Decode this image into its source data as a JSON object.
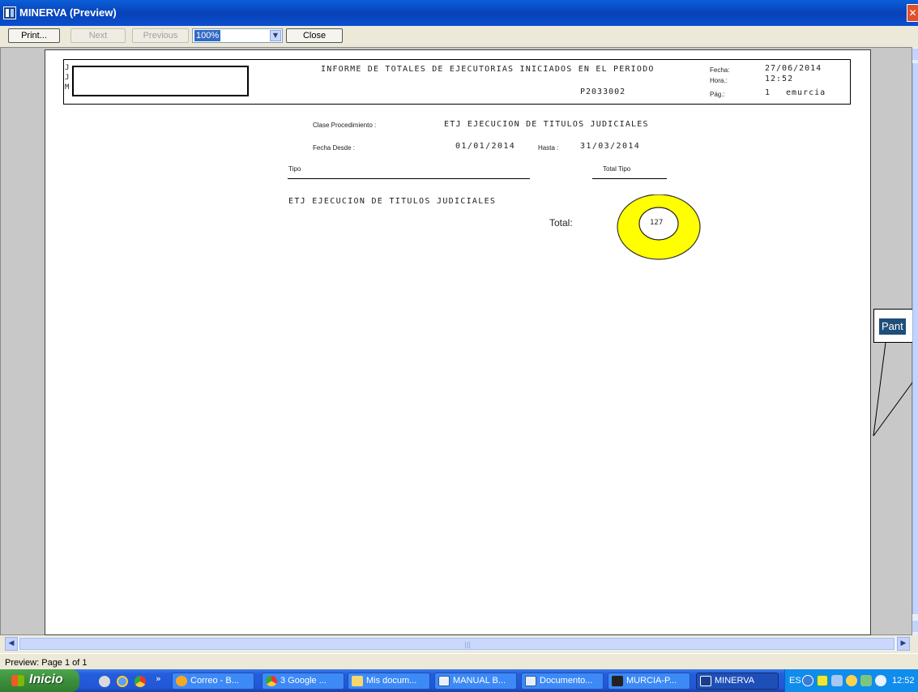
{
  "window": {
    "title": "MINERVA (Preview)"
  },
  "toolbar": {
    "print_label": "Print...",
    "next_label": "Next",
    "previous_label": "Previous",
    "zoom_value": "100%",
    "close_label": "Close"
  },
  "report": {
    "header": {
      "title": "INFORME DE TOTALES DE EJECUTORIAS INICIADOS EN EL PERIODO",
      "code": "P2033002",
      "left_letters": [
        "J",
        "J",
        "M"
      ],
      "fecha_label": "Fecha:",
      "fecha_value": "27/06/2014",
      "hora_label": "Hora.:",
      "hora_value": "12:52",
      "pag_label": "Pág.:",
      "pag_value": "1",
      "user": "emurcia"
    },
    "clase_label": "Clase Procedimiento :",
    "clase_value": "ETJ EJECUCION DE TITULOS JUDICIALES",
    "fecha_desde_label": "Fecha Desde :",
    "fecha_desde_value": "01/01/2014",
    "hasta_label": "Hasta :",
    "hasta_value": "31/03/2014",
    "col_tipo": "Tipo",
    "col_total_tipo": "Total Tipo",
    "row_label": "ETJ EJECUCION DE TITULOS JUDICIALES",
    "total_label": "Total:",
    "total_value": "127"
  },
  "callout": {
    "text": "Pant"
  },
  "status": {
    "text": "Preview: Page 1 of 1"
  },
  "taskbar": {
    "start_label": "Inicio",
    "quicklaunch_more": "»",
    "tasks": [
      {
        "label": "Correo - B..."
      },
      {
        "label": "3 Google ..."
      },
      {
        "label": "Mis docum..."
      },
      {
        "label": "MANUAL B..."
      },
      {
        "label": "Documento..."
      },
      {
        "label": "MURCIA-P..."
      },
      {
        "label": "MINERVA"
      }
    ],
    "language": "ES",
    "clock": "12:52"
  },
  "colors": {
    "highlight_ring": "#ffff00",
    "callout_fill": "#1f4e79",
    "titlebar": "#0842b8",
    "close_button": "#e0502a"
  }
}
